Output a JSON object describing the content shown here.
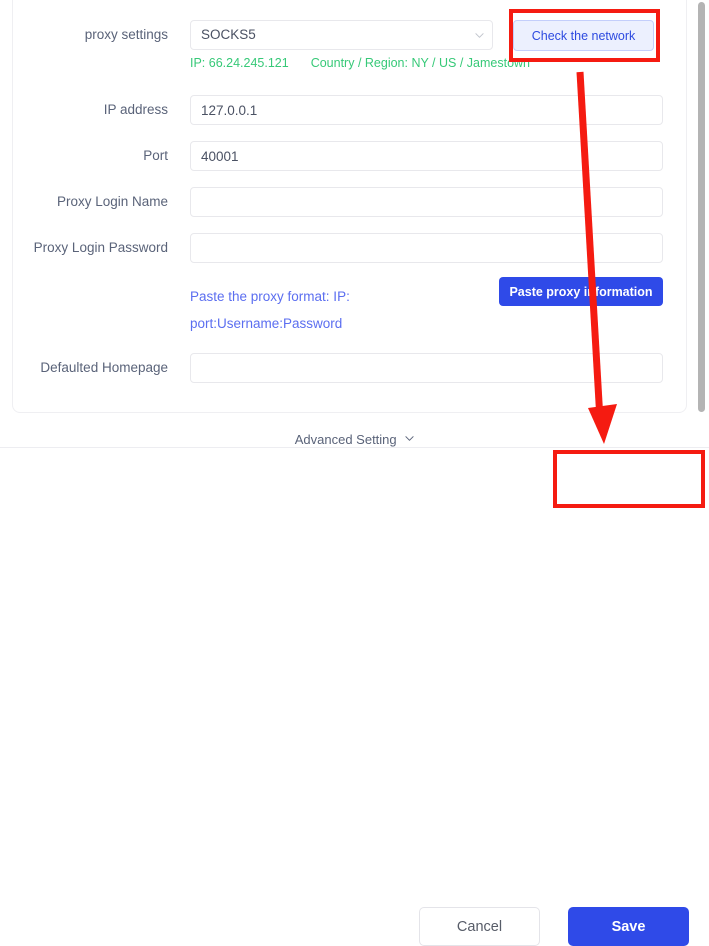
{
  "form": {
    "proxy_settings": {
      "label": "proxy settings",
      "value": "SOCKS5",
      "chevron_icon": "chevron-down-icon"
    },
    "check_network_button": "Check the network",
    "network_status": {
      "ip": "IP: 66.24.245.121",
      "region": "Country / Region: NY / US / Jamestown"
    },
    "fields": [
      {
        "label": "IP address",
        "value": "127.0.0.1",
        "placeholder": ""
      },
      {
        "label": "Port",
        "value": "40001",
        "placeholder": ""
      },
      {
        "label": "Proxy Login Name",
        "value": "",
        "placeholder": ""
      },
      {
        "label": "Proxy Login Password",
        "value": "",
        "placeholder": ""
      },
      {
        "label": "Defaulted Homepage",
        "value": "",
        "placeholder": ""
      }
    ],
    "paste_hint_line1": "Paste the proxy format: IP:",
    "paste_hint_line2": "port:Username:Password",
    "paste_proxy_button": "Paste proxy information",
    "advanced_setting": "Advanced Setting",
    "advanced_setting_chevron": "chevron-down-icon"
  },
  "footer": {
    "cancel_label": "Cancel",
    "save_label": "Save"
  },
  "colors": {
    "primary_blue": "#2f4ae8",
    "light_blue_bg": "#ecf0fe",
    "status_green": "#37c978",
    "annotation_red": "#f51b11",
    "label_gray": "#5a6379",
    "border_gray": "#e8e8ec"
  }
}
